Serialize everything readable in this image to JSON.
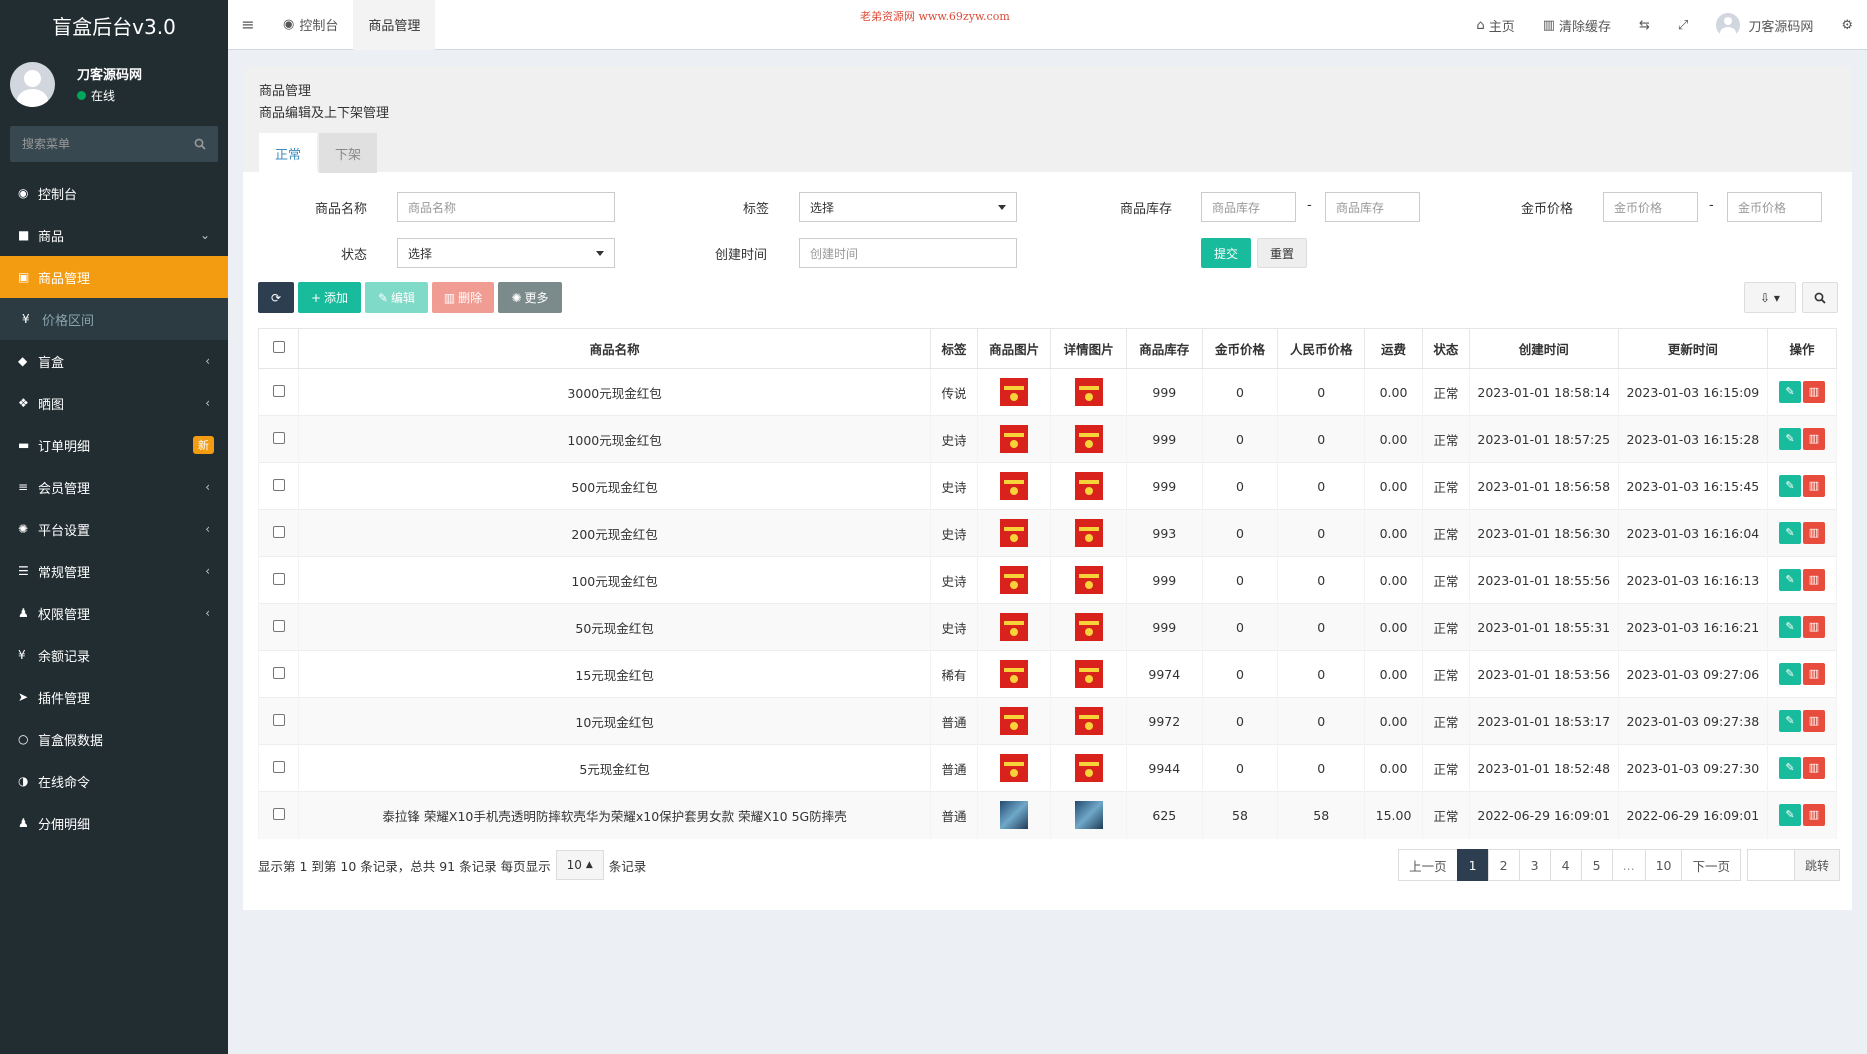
{
  "app": {
    "title": "盲盒后台v3.0",
    "user_name": "刀客源码网",
    "user_status": "在线",
    "search_placeholder": "搜索菜单"
  },
  "sidebar": {
    "items": [
      {
        "label": "控制台",
        "icon": "dashboard-icon",
        "glyph": "◉",
        "arrow": ""
      },
      {
        "label": "商品",
        "icon": "bag-icon",
        "glyph": "■",
        "arrow": "⌄"
      },
      {
        "label": "商品管理",
        "icon": "cart-icon",
        "glyph": "▣",
        "arrow": ""
      },
      {
        "label": "价格区间",
        "icon": "yen-icon",
        "glyph": "¥",
        "arrow": ""
      },
      {
        "label": "盲盒",
        "icon": "cube-icon",
        "glyph": "◆",
        "arrow": "‹"
      },
      {
        "label": "晒图",
        "icon": "dropbox-icon",
        "glyph": "❖",
        "arrow": "‹"
      },
      {
        "label": "订单明细",
        "icon": "cart-icon",
        "glyph": "▬",
        "arrow": "",
        "badge": "新"
      },
      {
        "label": "会员管理",
        "icon": "list-icon",
        "glyph": "≡",
        "arrow": "‹"
      },
      {
        "label": "平台设置",
        "icon": "gear-icon",
        "glyph": "✺",
        "arrow": "‹"
      },
      {
        "label": "常规管理",
        "icon": "database-icon",
        "glyph": "☰",
        "arrow": "‹"
      },
      {
        "label": "权限管理",
        "icon": "users-icon",
        "glyph": "♟",
        "arrow": "‹"
      },
      {
        "label": "余额记录",
        "icon": "yen-icon",
        "glyph": "¥",
        "arrow": ""
      },
      {
        "label": "插件管理",
        "icon": "rocket-icon",
        "glyph": "➤",
        "arrow": ""
      },
      {
        "label": "盲盒假数据",
        "icon": "circle-icon",
        "glyph": "○",
        "arrow": ""
      },
      {
        "label": "在线命令",
        "icon": "adjust-icon",
        "glyph": "◑",
        "arrow": ""
      },
      {
        "label": "分佣明细",
        "icon": "users-icon",
        "glyph": "♟",
        "arrow": ""
      }
    ]
  },
  "topbar": {
    "tab_dashboard": "控制台",
    "tab_goods": "商品管理",
    "watermark": "老弟资源网 www.69zyw.com",
    "home": "主页",
    "clear_cache": "清除缓存",
    "user_name": "刀客源码网"
  },
  "page": {
    "title": "商品管理",
    "subtitle": "商品编辑及上下架管理",
    "tab_normal": "正常",
    "tab_off": "下架"
  },
  "filter": {
    "name_label": "商品名称",
    "name_placeholder": "商品名称",
    "tag_label": "标签",
    "tag_value": "选择",
    "stock_label": "商品库存",
    "stock_placeholder": "商品库存",
    "coin_label": "金币价格",
    "coin_placeholder": "金币价格",
    "dash": "-",
    "status_label": "状态",
    "status_value": "选择",
    "created_label": "创建时间",
    "created_placeholder": "创建时间",
    "submit": "提交",
    "reset": "重置"
  },
  "toolbar": {
    "add": "添加",
    "edit": "编辑",
    "delete": "删除",
    "more": "更多"
  },
  "table": {
    "headers": [
      "商品名称",
      "标签",
      "商品图片",
      "详情图片",
      "商品库存",
      "金币价格",
      "人民币价格",
      "运费",
      "状态",
      "创建时间",
      "更新时间",
      "操作"
    ],
    "rows": [
      {
        "name": "3000元现金红包",
        "tag": "传说",
        "tag_class": "legend",
        "img": "red",
        "stock": "999",
        "coin": "0",
        "rmb": "0",
        "fee": "0.00",
        "status": "正常",
        "created": "2023-01-01 18:58:14",
        "updated": "2023-01-03 16:15:09"
      },
      {
        "name": "1000元现金红包",
        "tag": "史诗",
        "tag_class": "epic",
        "img": "red",
        "stock": "999",
        "coin": "0",
        "rmb": "0",
        "fee": "0.00",
        "status": "正常",
        "created": "2023-01-01 18:57:25",
        "updated": "2023-01-03 16:15:28"
      },
      {
        "name": "500元现金红包",
        "tag": "史诗",
        "tag_class": "epic",
        "img": "red",
        "stock": "999",
        "coin": "0",
        "rmb": "0",
        "fee": "0.00",
        "status": "正常",
        "created": "2023-01-01 18:56:58",
        "updated": "2023-01-03 16:15:45"
      },
      {
        "name": "200元现金红包",
        "tag": "史诗",
        "tag_class": "epic",
        "img": "red",
        "stock": "993",
        "coin": "0",
        "rmb": "0",
        "fee": "0.00",
        "status": "正常",
        "created": "2023-01-01 18:56:30",
        "updated": "2023-01-03 16:16:04"
      },
      {
        "name": "100元现金红包",
        "tag": "史诗",
        "tag_class": "epic",
        "img": "red",
        "stock": "999",
        "coin": "0",
        "rmb": "0",
        "fee": "0.00",
        "status": "正常",
        "created": "2023-01-01 18:55:56",
        "updated": "2023-01-03 16:16:13"
      },
      {
        "name": "50元现金红包",
        "tag": "史诗",
        "tag_class": "epic",
        "img": "red",
        "stock": "999",
        "coin": "0",
        "rmb": "0",
        "fee": "0.00",
        "status": "正常",
        "created": "2023-01-01 18:55:31",
        "updated": "2023-01-03 16:16:21"
      },
      {
        "name": "15元现金红包",
        "tag": "稀有",
        "tag_class": "rare",
        "img": "red",
        "stock": "9974",
        "coin": "0",
        "rmb": "0",
        "fee": "0.00",
        "status": "正常",
        "created": "2023-01-01 18:53:56",
        "updated": "2023-01-03 09:27:06"
      },
      {
        "name": "10元现金红包",
        "tag": "普通",
        "tag_class": "normal",
        "img": "red",
        "stock": "9972",
        "coin": "0",
        "rmb": "0",
        "fee": "0.00",
        "status": "正常",
        "created": "2023-01-01 18:53:17",
        "updated": "2023-01-03 09:27:38"
      },
      {
        "name": "5元现金红包",
        "tag": "普通",
        "tag_class": "normal",
        "img": "red",
        "stock": "9944",
        "coin": "0",
        "rmb": "0",
        "fee": "0.00",
        "status": "正常",
        "created": "2023-01-01 18:52:48",
        "updated": "2023-01-03 09:27:30"
      },
      {
        "name": "泰拉锋 荣耀X10手机壳透明防摔软壳华为荣耀x10保护套男女款 荣耀X10 5G防摔壳",
        "tag": "普通",
        "tag_class": "normal",
        "img": "blue",
        "stock": "625",
        "coin": "58",
        "rmb": "58",
        "fee": "15.00",
        "status": "正常",
        "created": "2022-06-29 16:09:01",
        "updated": "2022-06-29 16:09:01"
      }
    ]
  },
  "footer": {
    "info_prefix": "显示第 1 到第 10 条记录，总共 91 条记录 每页显示",
    "page_size": "10",
    "info_suffix": "条记录",
    "prev": "上一页",
    "pages": [
      "1",
      "2",
      "3",
      "4",
      "5",
      "...",
      "10"
    ],
    "current_page": "1",
    "next": "下一页",
    "jump": "跳转"
  },
  "colors": {
    "sidebar_bg": "#222d32",
    "active_menu": "#f39c12",
    "success": "#18bc9c",
    "danger": "#e74c3c",
    "primary_dark": "#2c3e50"
  }
}
